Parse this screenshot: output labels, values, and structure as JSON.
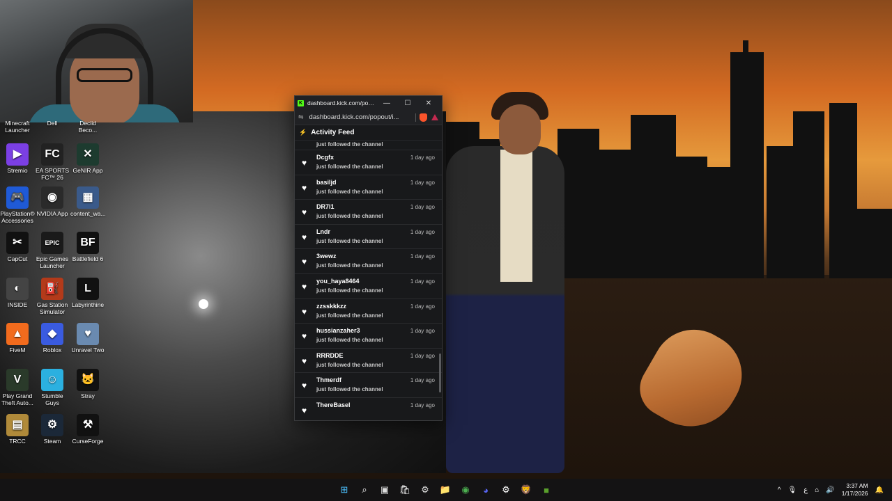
{
  "popout": {
    "title": "dashboard.kick.com/popout...",
    "url": "dashboard.kick.com/popout/i...",
    "feed_title": "Activity Feed",
    "partial_top_action": "just followed the channel",
    "items": [
      {
        "user": "Dcgfx",
        "time": "1 day ago",
        "action": "just followed the channel"
      },
      {
        "user": "basiljd",
        "time": "1 day ago",
        "action": "just followed the channel"
      },
      {
        "user": "DR7l1",
        "time": "1 day ago",
        "action": "just followed the channel"
      },
      {
        "user": "Lndr",
        "time": "1 day ago",
        "action": "just followed the channel"
      },
      {
        "user": "3wewz",
        "time": "1 day ago",
        "action": "just followed the channel"
      },
      {
        "user": "you_haya8464",
        "time": "1 day ago",
        "action": "just followed the channel"
      },
      {
        "user": "zzsskkkzz",
        "time": "1 day ago",
        "action": "just followed the channel"
      },
      {
        "user": "hussianzaher3",
        "time": "1 day ago",
        "action": "just followed the channel"
      },
      {
        "user": "RRRDDE",
        "time": "1 day ago",
        "action": "just followed the channel"
      },
      {
        "user": "Thmerdf",
        "time": "1 day ago",
        "action": "just followed the channel"
      },
      {
        "user": "ThereBasel",
        "time": "1 day ago",
        "action": ""
      }
    ],
    "colors": {
      "kick_green": "#53fc18",
      "panel_bg": "#18191b"
    }
  },
  "desktop": {
    "partial_labels": [
      "Minecraft Launcher",
      "Dell",
      "Deciid Beco..."
    ],
    "icons": [
      {
        "label": "Stremio",
        "icon": "stremio-icon",
        "color": "#7b3fe4",
        "glyph": "▶"
      },
      {
        "label": "EA SPORTS FC™ 26",
        "icon": "ea-fc-icon",
        "color": "#222",
        "glyph": "FC"
      },
      {
        "label": "GeNIR App",
        "icon": "genir-icon",
        "color": "#1d3b2f",
        "glyph": "✕"
      },
      {
        "label": "PlayStation® Accessories",
        "icon": "playstation-icon",
        "color": "#1f5ad6",
        "glyph": "🎮"
      },
      {
        "label": "NVIDIA App",
        "icon": "nvidia-icon",
        "color": "#2a2a2a",
        "glyph": "◉"
      },
      {
        "label": "content_wa...",
        "icon": "image-file-icon",
        "color": "#3a5a8a",
        "glyph": "▦"
      },
      {
        "label": "CapCut",
        "icon": "capcut-icon",
        "color": "#111",
        "glyph": "✂"
      },
      {
        "label": "Epic Games Launcher",
        "icon": "epic-games-icon",
        "color": "#1a1a1a",
        "glyph": "EPIC"
      },
      {
        "label": "Battlefield 6",
        "icon": "battlefield-icon",
        "color": "#111",
        "glyph": "BF"
      },
      {
        "label": "INSIDE",
        "icon": "inside-icon",
        "color": "#444",
        "glyph": "◐"
      },
      {
        "label": "Gas Station Simulator",
        "icon": "gas-station-icon",
        "color": "#b33a1a",
        "glyph": "⛽"
      },
      {
        "label": "Labyrinthine",
        "icon": "labyrinthine-icon",
        "color": "#111",
        "glyph": "L"
      },
      {
        "label": "FiveM",
        "icon": "fivem-icon",
        "color": "#f26b1d",
        "glyph": "▲"
      },
      {
        "label": "Roblox",
        "icon": "roblox-icon",
        "color": "#3a5be0",
        "glyph": "◆"
      },
      {
        "label": "Unravel Two",
        "icon": "unravel-icon",
        "color": "#6a8ab0",
        "glyph": "♥"
      },
      {
        "label": "Play Grand Theft Auto...",
        "icon": "gta-icon",
        "color": "#2a3a2a",
        "glyph": "V"
      },
      {
        "label": "Stumble Guys",
        "icon": "stumble-guys-icon",
        "color": "#2bb0e0",
        "glyph": "☺"
      },
      {
        "label": "Stray",
        "icon": "stray-icon",
        "color": "#111",
        "glyph": "🐱"
      },
      {
        "label": "TRCC",
        "icon": "trcc-icon",
        "color": "#b08a3a",
        "glyph": "▤"
      },
      {
        "label": "Steam",
        "icon": "steam-icon",
        "color": "#1b2838",
        "glyph": "⚙"
      },
      {
        "label": "CurseForge",
        "icon": "curseforge-icon",
        "color": "#111",
        "glyph": "⚒"
      }
    ]
  },
  "taskbar": {
    "apps": [
      {
        "name": "start-button",
        "glyph": "⊞",
        "color": "#4cc2ff"
      },
      {
        "name": "search-icon",
        "glyph": "⌕",
        "color": "#fff"
      },
      {
        "name": "task-view-icon",
        "glyph": "▣",
        "color": "#ddd"
      },
      {
        "name": "store-icon",
        "glyph": "🛍",
        "color": "#fff"
      },
      {
        "name": "settings-app-icon",
        "glyph": "⚙",
        "color": "#ddd"
      },
      {
        "name": "file-explorer-icon",
        "glyph": "📁",
        "color": "#f5c542"
      },
      {
        "name": "chrome-icon",
        "glyph": "◉",
        "color": "#4caf50"
      },
      {
        "name": "discord-icon",
        "glyph": "◕",
        "color": "#5865f2"
      },
      {
        "name": "steam-taskbar-icon",
        "glyph": "⚙",
        "color": "#fff"
      },
      {
        "name": "brave-icon",
        "glyph": "🦁",
        "color": "#fb542b"
      },
      {
        "name": "minecraft-icon",
        "glyph": "■",
        "color": "#5aa02c"
      }
    ],
    "tray": {
      "chevron": "^",
      "mic": "🎙",
      "lang": "ع",
      "network": "⌂",
      "volume": "🔊",
      "time": "3:37 AM",
      "date": "1/17/2026",
      "notification": "🔔"
    }
  }
}
